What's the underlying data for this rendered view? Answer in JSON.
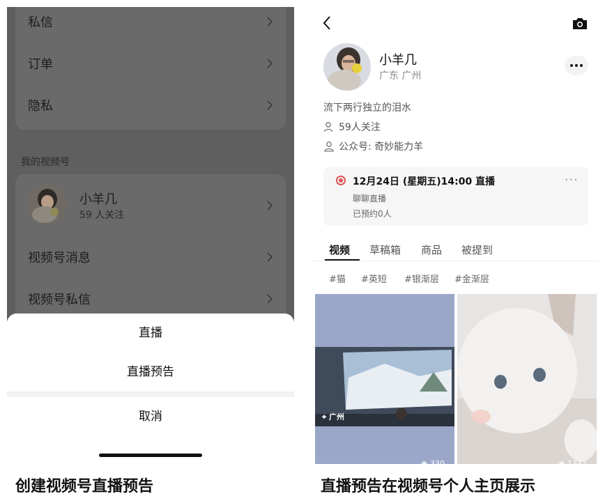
{
  "left_phone": {
    "menu": [
      {
        "label": "私信"
      },
      {
        "label": "订单"
      },
      {
        "label": "隐私"
      }
    ],
    "section_title": "我的视频号",
    "profile": {
      "name": "小羊几",
      "followers": "59 人关注"
    },
    "channel_items": [
      {
        "label": "视频号消息"
      },
      {
        "label": "视频号私信"
      }
    ],
    "sheet": {
      "options": [
        "直播",
        "直播预告"
      ],
      "cancel": "取消"
    }
  },
  "right_phone": {
    "profile": {
      "name": "小羊几",
      "location": "广东 广州",
      "bio": "流下两行独立的泪水",
      "followers": "59人关注",
      "official_account": "公众号: 奇妙能力羊"
    },
    "live": {
      "title": "12月24日 (星期五)14:00 直播",
      "subtitle": "聊聊直播",
      "reservations": "已预约0人"
    },
    "tabs": [
      "视频",
      "草稿箱",
      "商品",
      "被提到"
    ],
    "active_tab": "视频",
    "tags": [
      "#猫",
      "#英短",
      "#银渐层",
      "#金渐层"
    ],
    "videos": [
      {
        "location": "广州",
        "views": "330"
      },
      {
        "views": "1332"
      }
    ]
  },
  "captions": {
    "left": "创建视频号直播预告",
    "right": "直播预告在视频号个人主页展示"
  },
  "colors": {
    "overlay_bg": "#5f5f5f",
    "live_accent": "#e05555"
  }
}
